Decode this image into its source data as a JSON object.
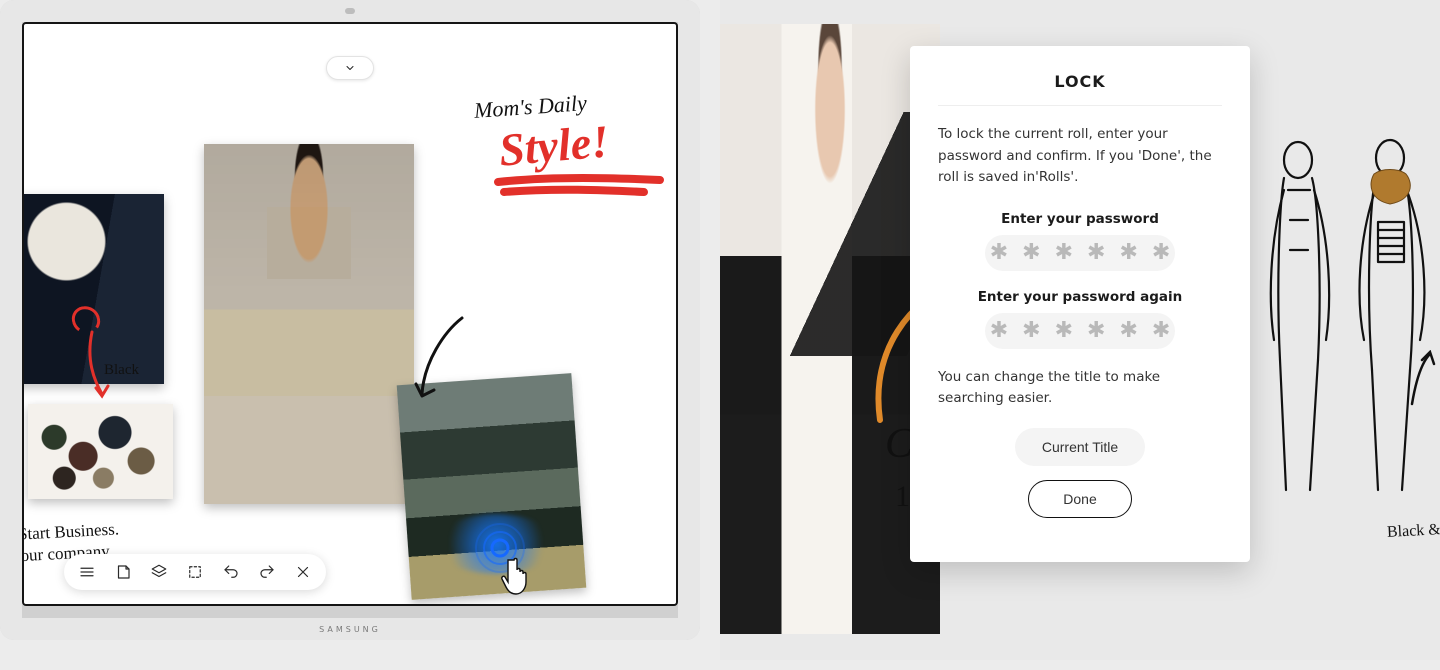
{
  "left": {
    "brand": "SAMSUNG",
    "title_line1": "Mom's Daily",
    "title_line2": "Style!",
    "label_black": "Black",
    "biz_line1": "Start Business.",
    "biz_line2": "your company",
    "toolbar_icons": [
      "menu",
      "note",
      "layers",
      "select",
      "undo",
      "redo",
      "close"
    ]
  },
  "right": {
    "cursive_letter": "C",
    "number": "1",
    "sketch_label": "Black & co"
  },
  "dialog": {
    "title": "LOCK",
    "description": "To lock the current roll, enter your password and confirm. If you 'Done', the roll is saved in'Rolls'.",
    "pw1_label": "Enter your password",
    "pw2_label": "Enter your password again",
    "mask_char": "✱",
    "mask_count": 6,
    "hint": "You can change the title to make searching easier.",
    "title_input_placeholder": "Current Title",
    "done_label": "Done"
  }
}
